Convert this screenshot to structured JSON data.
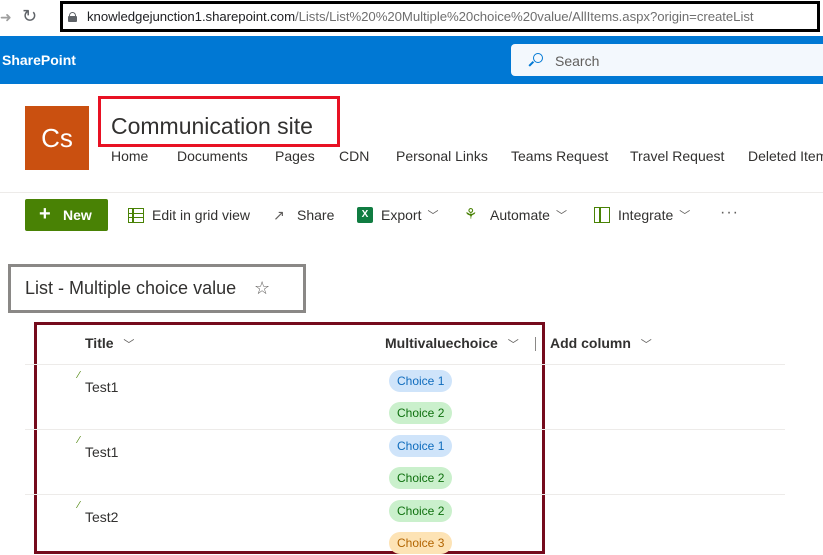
{
  "browser": {
    "url_domain": "knowledgejunction1.sharepoint.com",
    "url_path": "/Lists/List%20%20Multiple%20choice%20value/AllItems.aspx?origin=createList"
  },
  "suite": {
    "brand": "SharePoint",
    "search_placeholder": "Search"
  },
  "site": {
    "logo_text": "Cs",
    "title": "Communication site",
    "nav": [
      "Home",
      "Documents",
      "Pages",
      "CDN",
      "Personal Links",
      "Teams Request",
      "Travel Request",
      "Deleted Items"
    ]
  },
  "command_bar": {
    "new": "New",
    "edit_grid": "Edit in grid view",
    "share": "Share",
    "export": "Export",
    "automate": "Automate",
    "integrate": "Integrate",
    "more": "···"
  },
  "list": {
    "title": "List - Multiple choice value",
    "columns": {
      "title": "Title",
      "multi": "Multivaluechoice",
      "add": "Add column"
    },
    "rows": [
      {
        "title": "Test1",
        "choices": [
          "Choice 1",
          "Choice 2"
        ]
      },
      {
        "title": "Test1",
        "choices": [
          "Choice 1",
          "Choice 2"
        ]
      },
      {
        "title": "Test2",
        "choices": [
          "Choice 2",
          "Choice 3"
        ]
      }
    ]
  },
  "colors": {
    "suite_bar": "#0078d4",
    "new_button": "#498205",
    "site_logo": "#ca5010",
    "highlight_title": "#e81123",
    "highlight_list": "#750b1c",
    "highlight_url": "#000000",
    "highlight_list_title": "#8a8886"
  }
}
